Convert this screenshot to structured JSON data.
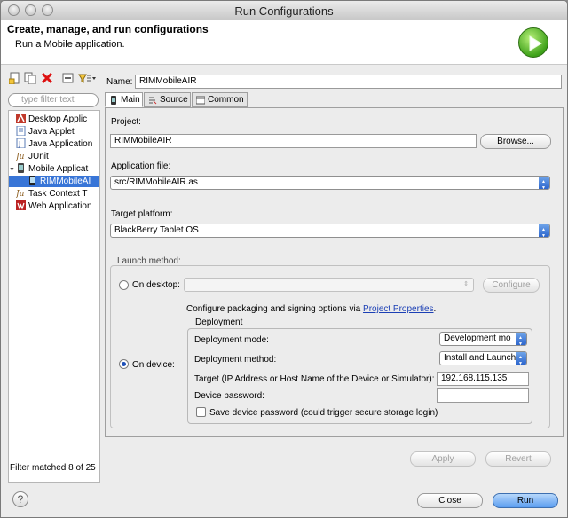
{
  "window": {
    "title": "Run Configurations"
  },
  "header": {
    "title": "Create, manage, and run configurations",
    "subtitle": "Run a Mobile application."
  },
  "left": {
    "filter_placeholder": "type filter text",
    "tree": [
      {
        "label": "Desktop Applic"
      },
      {
        "label": "Java Applet"
      },
      {
        "label": "Java Application"
      },
      {
        "label": "JUnit"
      },
      {
        "label": "Mobile Applicat"
      },
      {
        "label": "RIMMobileAI"
      },
      {
        "label": "Task Context T"
      },
      {
        "label": "Web Application"
      }
    ],
    "filter_status": "Filter matched 8 of 25"
  },
  "form": {
    "name_label": "Name:",
    "name_value": "RIMMobileAIR",
    "tabs": [
      {
        "label": "Main"
      },
      {
        "label": "Source"
      },
      {
        "label": "Common"
      }
    ],
    "project_label": "Project:",
    "project_value": "RIMMobileAIR",
    "browse_label": "Browse...",
    "app_file_label": "Application file:",
    "app_file_value": "src/RIMMobileAIR.as",
    "target_platform_label": "Target platform:",
    "target_platform_value": "BlackBerry Tablet OS",
    "launch_method_label": "Launch method:",
    "on_desktop_label": "On desktop:",
    "configure_label": "Configure",
    "packaging_text": "Configure packaging and signing options via",
    "project_properties_link": "Project Properties",
    "period": ".",
    "deployment_label": "Deployment",
    "on_device_label": "On device:",
    "deploy_mode_label": "Deployment mode:",
    "deploy_mode_value": "Development mo",
    "deploy_method_label": "Deployment method:",
    "deploy_method_value": "Install and Launch",
    "target_label": "Target (IP Address or Host Name of the Device or Simulator):",
    "target_value": "192.168.115.135",
    "password_label": "Device password:",
    "password_value": "",
    "save_password_label": "Save device password (could trigger secure storage login)"
  },
  "buttons": {
    "apply": "Apply",
    "revert": "Revert",
    "close": "Close",
    "run": "Run",
    "help": "?"
  }
}
